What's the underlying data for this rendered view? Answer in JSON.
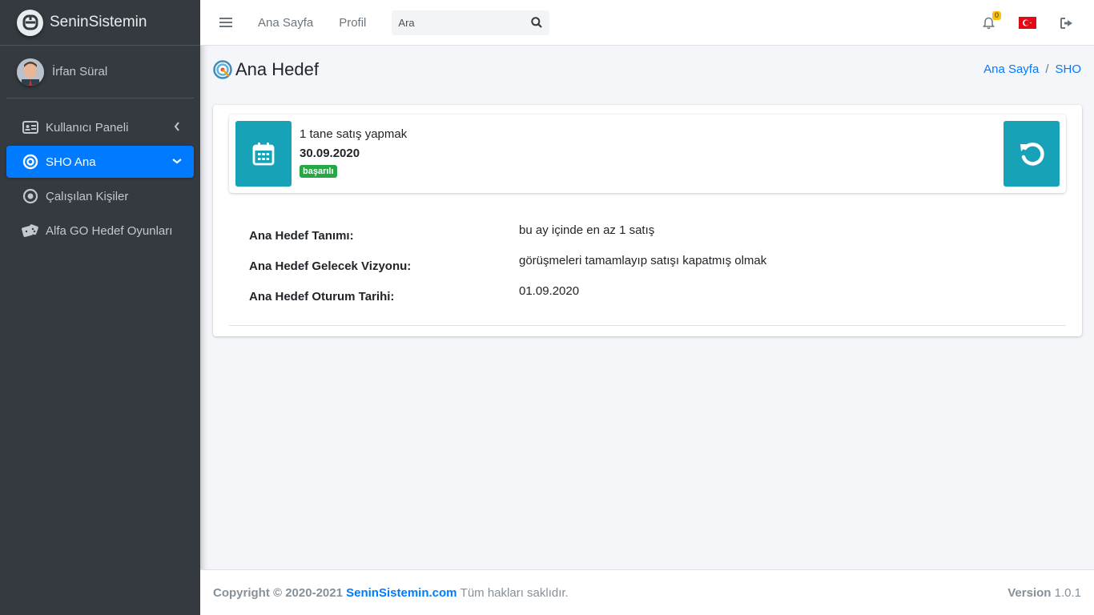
{
  "brand": {
    "name": "SeninSistemin"
  },
  "user": {
    "name": "İrfan Süral"
  },
  "sidebar": {
    "items": [
      {
        "label": "Kullanıcı Paneli",
        "icon": "id-card-icon",
        "active": false
      },
      {
        "label": "SHO Ana",
        "icon": "target-circle-icon",
        "active": true
      },
      {
        "label": "Çalışılan Kişiler",
        "icon": "dot-circle-icon",
        "active": false
      },
      {
        "label": "Alfa GO Hedef Oyunları",
        "icon": "dice-icon",
        "active": false
      }
    ]
  },
  "topbar": {
    "links": [
      "Ana Sayfa",
      "Profil"
    ],
    "search_placeholder": "Ara",
    "notification_count": "0"
  },
  "page": {
    "title": "Ana Hedef",
    "breadcrumb": [
      "Ana Sayfa",
      "SHO"
    ]
  },
  "goal": {
    "title": "1 tane satış yapmak",
    "date": "30.09.2020",
    "status": "başarılı",
    "status_color": "#28a745"
  },
  "details": [
    {
      "label": "Ana Hedef Tanımı:",
      "value": "bu ay içinde en az 1 satış"
    },
    {
      "label": "Ana Hedef Gelecek Vizyonu:",
      "value": "görüşmeleri tamamlayıp satışı kapatmış olmak"
    },
    {
      "label": "Ana Hedef Oturum Tarihi:",
      "value": "01.09.2020"
    }
  ],
  "footer": {
    "copyright": "Copyright © 2020-2021",
    "site": "SeninSistemin.com",
    "rights": "Tüm hakları saklıdır.",
    "version_label": "Version",
    "version": "1.0.1"
  },
  "colors": {
    "accent": "#007bff",
    "info": "#17a2b8",
    "sidebar": "#343a40"
  }
}
